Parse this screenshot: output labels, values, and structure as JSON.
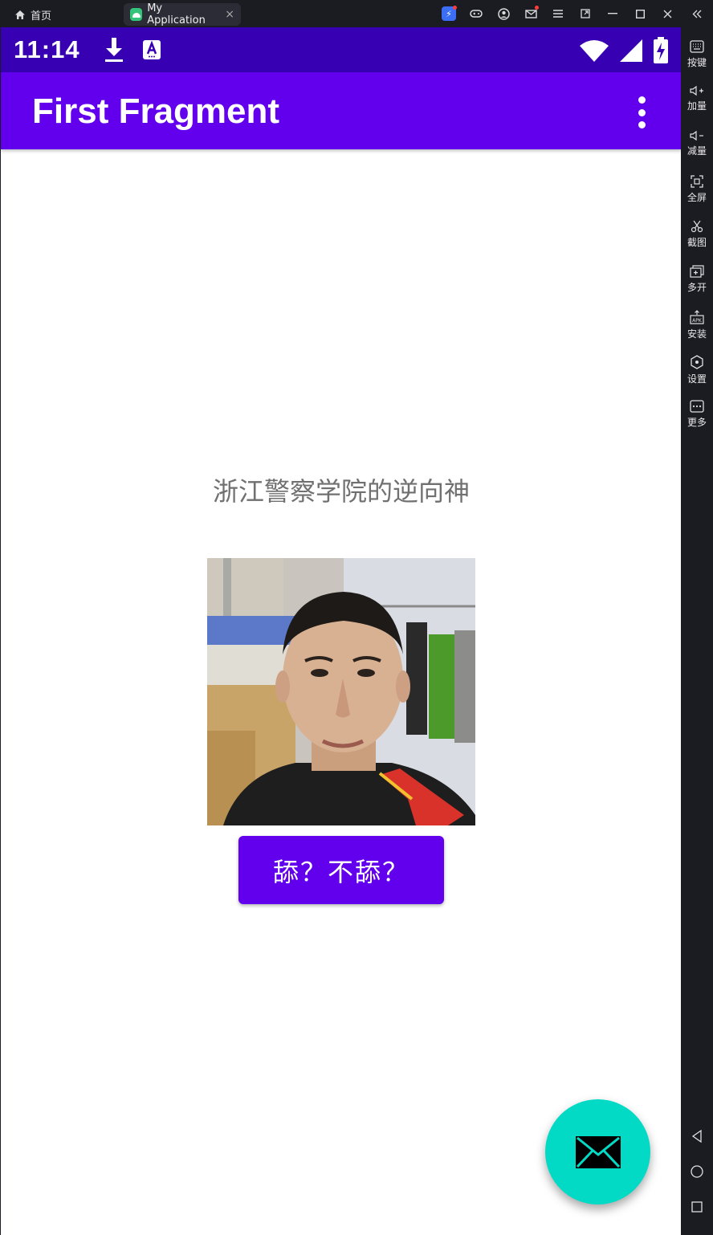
{
  "emulator": {
    "home_tab": "首页",
    "app_tab": "My Application",
    "close_tab": "×",
    "side_panel": [
      {
        "label": "按键",
        "icon": "keyboard-icon"
      },
      {
        "label": "加量",
        "icon": "volume-up-icon"
      },
      {
        "label": "减量",
        "icon": "volume-down-icon"
      },
      {
        "label": "全屏",
        "icon": "fullscreen-icon"
      },
      {
        "label": "截图",
        "icon": "scissors-icon"
      },
      {
        "label": "多开",
        "icon": "multi-instance-icon"
      },
      {
        "label": "安装",
        "icon": "apk-install-icon"
      },
      {
        "label": "设置",
        "icon": "settings-icon"
      },
      {
        "label": "更多",
        "icon": "more-icon"
      }
    ]
  },
  "status_bar": {
    "time": "11:14"
  },
  "app_bar": {
    "title": "First Fragment"
  },
  "content": {
    "text": "浙江警察学院的逆向神",
    "button_label": "舔？不舔？"
  },
  "colors": {
    "status_bar": "#3700b3",
    "primary": "#6200ee",
    "fab": "#03dac5"
  }
}
